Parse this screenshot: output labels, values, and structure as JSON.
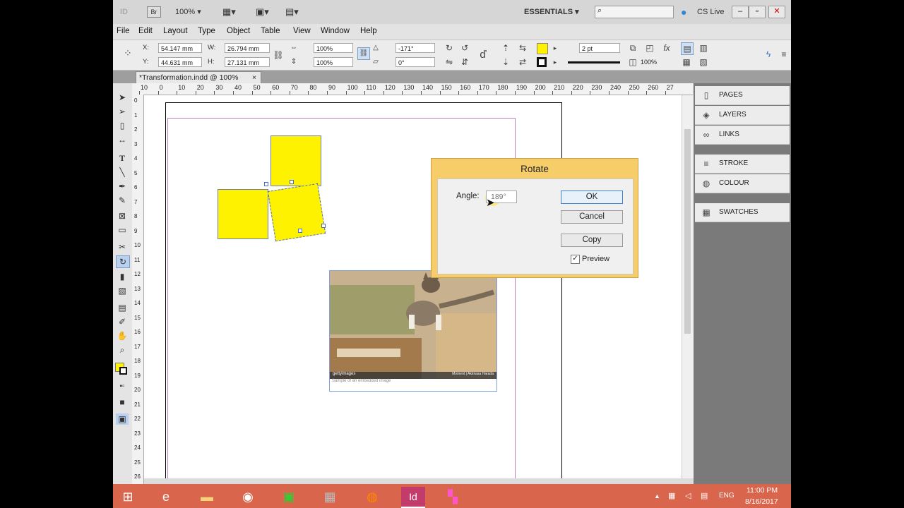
{
  "titlebar": {
    "app_id": "ID",
    "bridge": "Br",
    "zoom": "100%",
    "workspace": "ESSENTIALS",
    "cs_live": "CS Live",
    "search_placeholder": ""
  },
  "menu": [
    "File",
    "Edit",
    "Layout",
    "Type",
    "Object",
    "Table",
    "View",
    "Window",
    "Help"
  ],
  "control_panel": {
    "x_label": "X:",
    "x_value": "54.147 mm",
    "y_label": "Y:",
    "y_value": "44.631 mm",
    "w_label": "W:",
    "w_value": "26.794 mm",
    "h_label": "H:",
    "h_value": "27.131 mm",
    "scale_x": "100%",
    "scale_y": "100%",
    "rotate": "-171°",
    "shear": "0°",
    "stroke_weight": "2 pt",
    "opacity": "100%",
    "fill_color": "#fff200",
    "stroke_color": "#111111"
  },
  "document_tab": {
    "title": "*Transformation.indd @ 100%",
    "close": "×"
  },
  "ruler_top": [
    "10",
    "0",
    "10",
    "20",
    "30",
    "40",
    "50",
    "60",
    "70",
    "80",
    "90",
    "100",
    "110",
    "120",
    "130",
    "140",
    "150",
    "160",
    "170",
    "180",
    "190",
    "200",
    "210",
    "220",
    "230",
    "240",
    "250",
    "260",
    "27"
  ],
  "ruler_left": [
    "0",
    "1",
    "2",
    "3",
    "4",
    "5",
    "6",
    "7",
    "8",
    "9",
    "10",
    "11",
    "12",
    "13",
    "14",
    "15",
    "16",
    "17",
    "18",
    "19",
    "20",
    "21",
    "22",
    "23",
    "24",
    "25",
    "26"
  ],
  "photo": {
    "caption_left": "Sample of an embedded image",
    "credit": "Moment | Akimasa Harada",
    "watermark": "gettyimages"
  },
  "rotate_dialog": {
    "title": "Rotate",
    "angle_label": "Angle:",
    "angle_value": "189°",
    "ok": "OK",
    "cancel": "Cancel",
    "copy": "Copy",
    "preview_label": "Preview",
    "preview_checked": true
  },
  "panels": [
    {
      "label": "PAGES",
      "icon": "pages-icon"
    },
    {
      "label": "LAYERS",
      "icon": "layers-icon"
    },
    {
      "label": "LINKS",
      "icon": "links-icon"
    },
    {
      "label": "STROKE",
      "icon": "stroke-icon"
    },
    {
      "label": "COLOUR",
      "icon": "colour-icon"
    },
    {
      "label": "SWATCHES",
      "icon": "swatches-icon"
    }
  ],
  "taskbar": {
    "language": "ENG",
    "time": "11:00 PM",
    "date": "8/16/2017",
    "indesign_label": "Id"
  }
}
